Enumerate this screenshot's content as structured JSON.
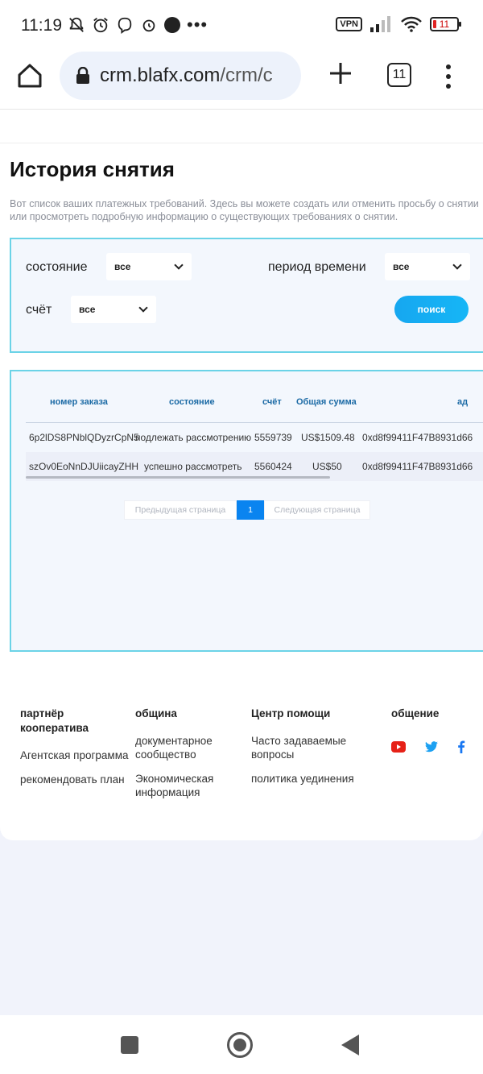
{
  "status_bar": {
    "time": "11:19",
    "vpn": "VPN",
    "battery": "11"
  },
  "browser": {
    "url_domain": "crm.blafx.com",
    "url_path": "/crm/c",
    "tab_count": "11"
  },
  "page": {
    "title": "История снятия",
    "description": "Вот список ваших платежных требований. Здесь вы можете создать или отменить просьбу о снятии или просмотреть подробную информацию о существующих требованиях о снятии."
  },
  "filters": {
    "state_label": "состояние",
    "state_value": "все",
    "period_label": "период времени",
    "period_value": "все",
    "account_label": "счёт",
    "account_value": "все",
    "search_button": "поиск"
  },
  "table": {
    "headers": [
      "номер заказа",
      "состояние",
      "счёт",
      "Общая сумма",
      "ад"
    ],
    "rows": [
      [
        "6p2lDS8PNblQDyzrCpN5",
        "подлежать рассмотрению",
        "5559739",
        "US$1509.48",
        "0xd8f99411F47B8931d66"
      ],
      [
        "szOv0EoNnDJUiicayZHH",
        "успешно рассмотреть",
        "5560424",
        "US$50",
        "0xd8f99411F47B8931d66"
      ]
    ]
  },
  "pagination": {
    "prev": "Предыдущая страница",
    "current": "1",
    "next": "Следующая страница"
  },
  "footer": {
    "col1": {
      "heading": "партнёр кооператива",
      "links": [
        "Агентская программа",
        "рекомендовать план"
      ]
    },
    "col2": {
      "heading": "община",
      "links": [
        "документарное сообщество",
        "Экономическая информация"
      ]
    },
    "col3": {
      "heading": "Центр помощи",
      "links": [
        "Часто задаваемые вопросы",
        "политика уединения"
      ]
    },
    "col4": {
      "heading": "общение",
      "icons": [
        "youtube-icon",
        "twitter-icon",
        "facebook-icon"
      ]
    }
  },
  "colors": {
    "accent": "#16a7f0",
    "border": "#6bd3e7",
    "header_text": "#1b6aa5",
    "youtube": "#e62117",
    "twitter": "#1da1f2",
    "facebook": "#1877f2"
  }
}
